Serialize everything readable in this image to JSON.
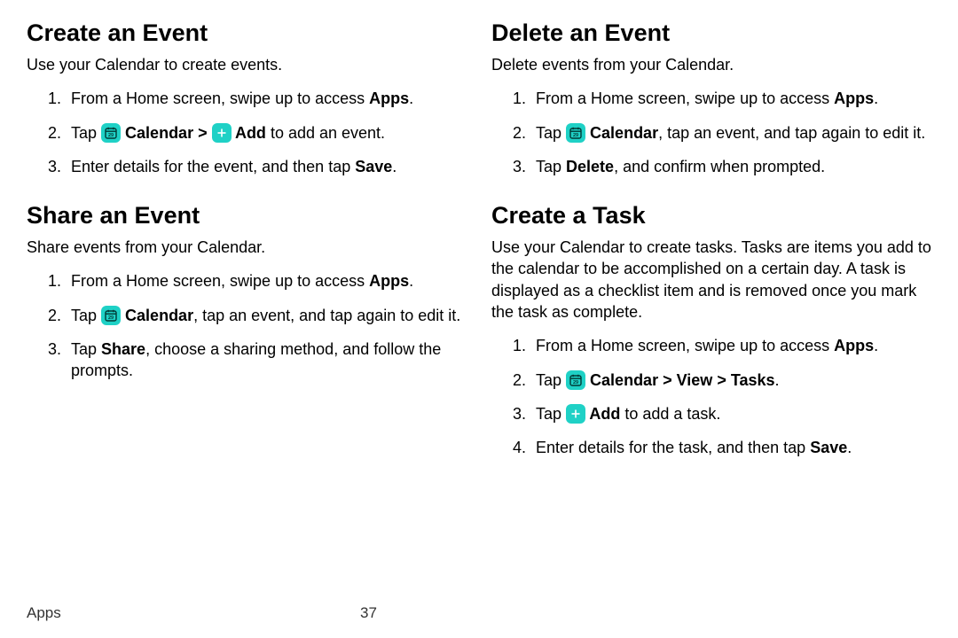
{
  "footer": {
    "section": "Apps",
    "page": "37"
  },
  "left": {
    "sec1": {
      "heading": "Create an Event",
      "intro": "Use your Calendar to create events.",
      "step1_a": "From a Home screen, swipe up to access ",
      "step1_b": "Apps",
      "step1_c": ".",
      "step2_a": "Tap ",
      "step2_b": "Calendar",
      "step2_c": " Add",
      "step2_d": " to add an event.",
      "step3_a": "Enter details for the event, and then tap ",
      "step3_b": "Save",
      "step3_c": "."
    },
    "sec2": {
      "heading": "Share an Event",
      "intro": "Share events from your Calendar.",
      "step1_a": "From a Home screen, swipe up to access ",
      "step1_b": "Apps",
      "step1_c": ".",
      "step2_a": "Tap ",
      "step2_b": "Calendar",
      "step2_c": ", tap an event, and tap again to edit it.",
      "step3_a": "Tap ",
      "step3_b": "Share",
      "step3_c": ", choose a sharing method, and follow the prompts."
    }
  },
  "right": {
    "sec1": {
      "heading": "Delete an Event",
      "intro": "Delete events from your Calendar.",
      "step1_a": "From a Home screen, swipe up to access ",
      "step1_b": "Apps",
      "step1_c": ".",
      "step2_a": "Tap ",
      "step2_b": "Calendar",
      "step2_c": ", tap an event, and tap again to edit it.",
      "step3_a": "Tap ",
      "step3_b": "Delete",
      "step3_c": ", and confirm when prompted."
    },
    "sec2": {
      "heading": "Create a Task",
      "intro": "Use your Calendar to create tasks. Tasks are items you add to the calendar to be accomplished on a certain day. A task is displayed as a checklist item and is removed once you mark the task as complete.",
      "step1_a": "From a Home screen, swipe up to access ",
      "step1_b": "Apps",
      "step1_c": ".",
      "step2_a": "Tap ",
      "step2_b": "Calendar",
      "step2_c": "View",
      "step2_d": "Tasks",
      "step2_e": ".",
      "step3_a": "Tap ",
      "step3_b": " Add",
      "step3_c": " to add a task.",
      "step4_a": "Enter details for the task, and then tap ",
      "step4_b": "Save",
      "step4_c": "."
    }
  },
  "chev": ">"
}
